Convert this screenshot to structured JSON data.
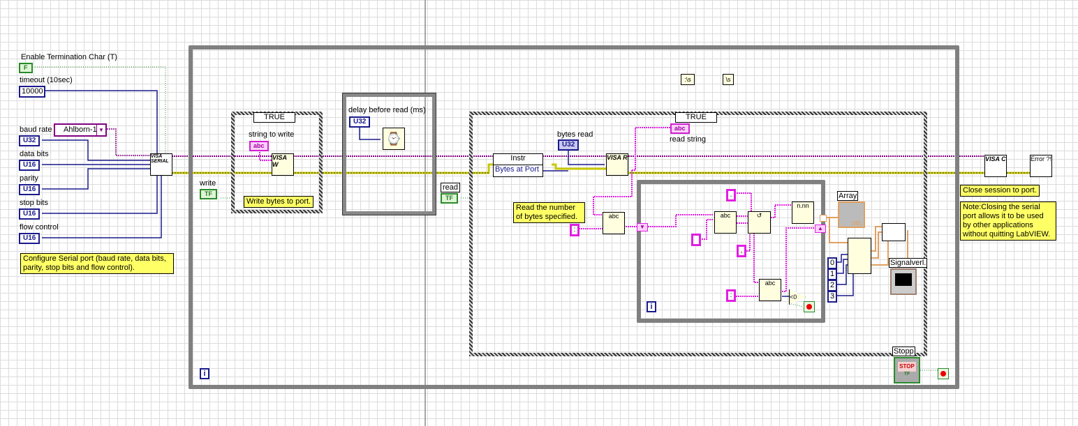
{
  "config": {
    "enable_term_label": "Enable Termination Char (T)",
    "enable_term_value": "F",
    "timeout_label": "timeout (10sec)",
    "timeout_value": "10000",
    "baud_label": "baud rate",
    "resource_value": "Ahlborn-1",
    "data_bits_label": "data bits",
    "parity_label": "parity",
    "stop_bits_label": "stop bits",
    "flow_label": "flow control",
    "u32": "U32",
    "u16": "U16",
    "note": "Configure Serial port (baud rate, data bits, parity, stop bits and flow control).",
    "visa_serial": "VISA SERIAL"
  },
  "write_case": {
    "selector": "TRUE",
    "string_label": "string to write",
    "string_type": "abc",
    "note": "Write bytes to port.",
    "write_label": "write",
    "tf": "TF",
    "node": "VISA W"
  },
  "sequence": {
    "delay_label": "delay before read (ms)",
    "u32": "U32"
  },
  "read_case": {
    "selector": "TRUE",
    "read_label": "read",
    "tf": "TF",
    "property_class": "Instr",
    "property_name": "Bytes at Port",
    "bytes_read_label": "bytes read",
    "u32": "U32",
    "read_string_label": "read string",
    "string_type": "abc",
    "note": "Read the number of bytes specified.",
    "node": "VISA R"
  },
  "constants": {
    "top1": ":\\s",
    "top2": "\\s",
    "c_colon1": ":",
    "c_colon2": ":",
    "c_dot": ".",
    "c_blank": "",
    "c_comma": ",",
    "idx0": "0",
    "idx1": "1",
    "idx2": "2",
    "idx3": "3",
    "compare": "<0"
  },
  "indicators": {
    "array_label": "Array",
    "array_type": "DBL",
    "graph_label": "Signalverl.",
    "stop_label": "Stopp",
    "stop_text": "STOP",
    "tf": "TF"
  },
  "close": {
    "note1": "Close session to port.",
    "note2": "Note:Closing the serial port allows it to be used by other applications without quitting LabVIEW.",
    "visa_close": "VISA C",
    "error": "Error ?!"
  },
  "loops": {
    "iteration": "i"
  },
  "colors": {
    "refnum_wire": "#800080",
    "error_wire": "#c8c800",
    "numeric": "#1a1a8c",
    "string": "#e020e0",
    "boolean": "#2a8a2a",
    "dbl": "#e0a060"
  }
}
